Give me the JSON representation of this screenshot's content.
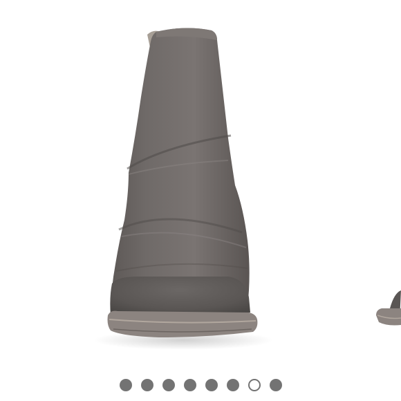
{
  "gallery": {
    "current_image": {
      "alt": ""
    },
    "next_image": {
      "alt": ""
    },
    "pagination": {
      "total": 8,
      "active_index": 6,
      "dot_color": "#737373",
      "active_fill": "#ffffff"
    }
  },
  "product": {
    "upper_color": "#6f6a68",
    "sole_color": "#8c8480"
  }
}
